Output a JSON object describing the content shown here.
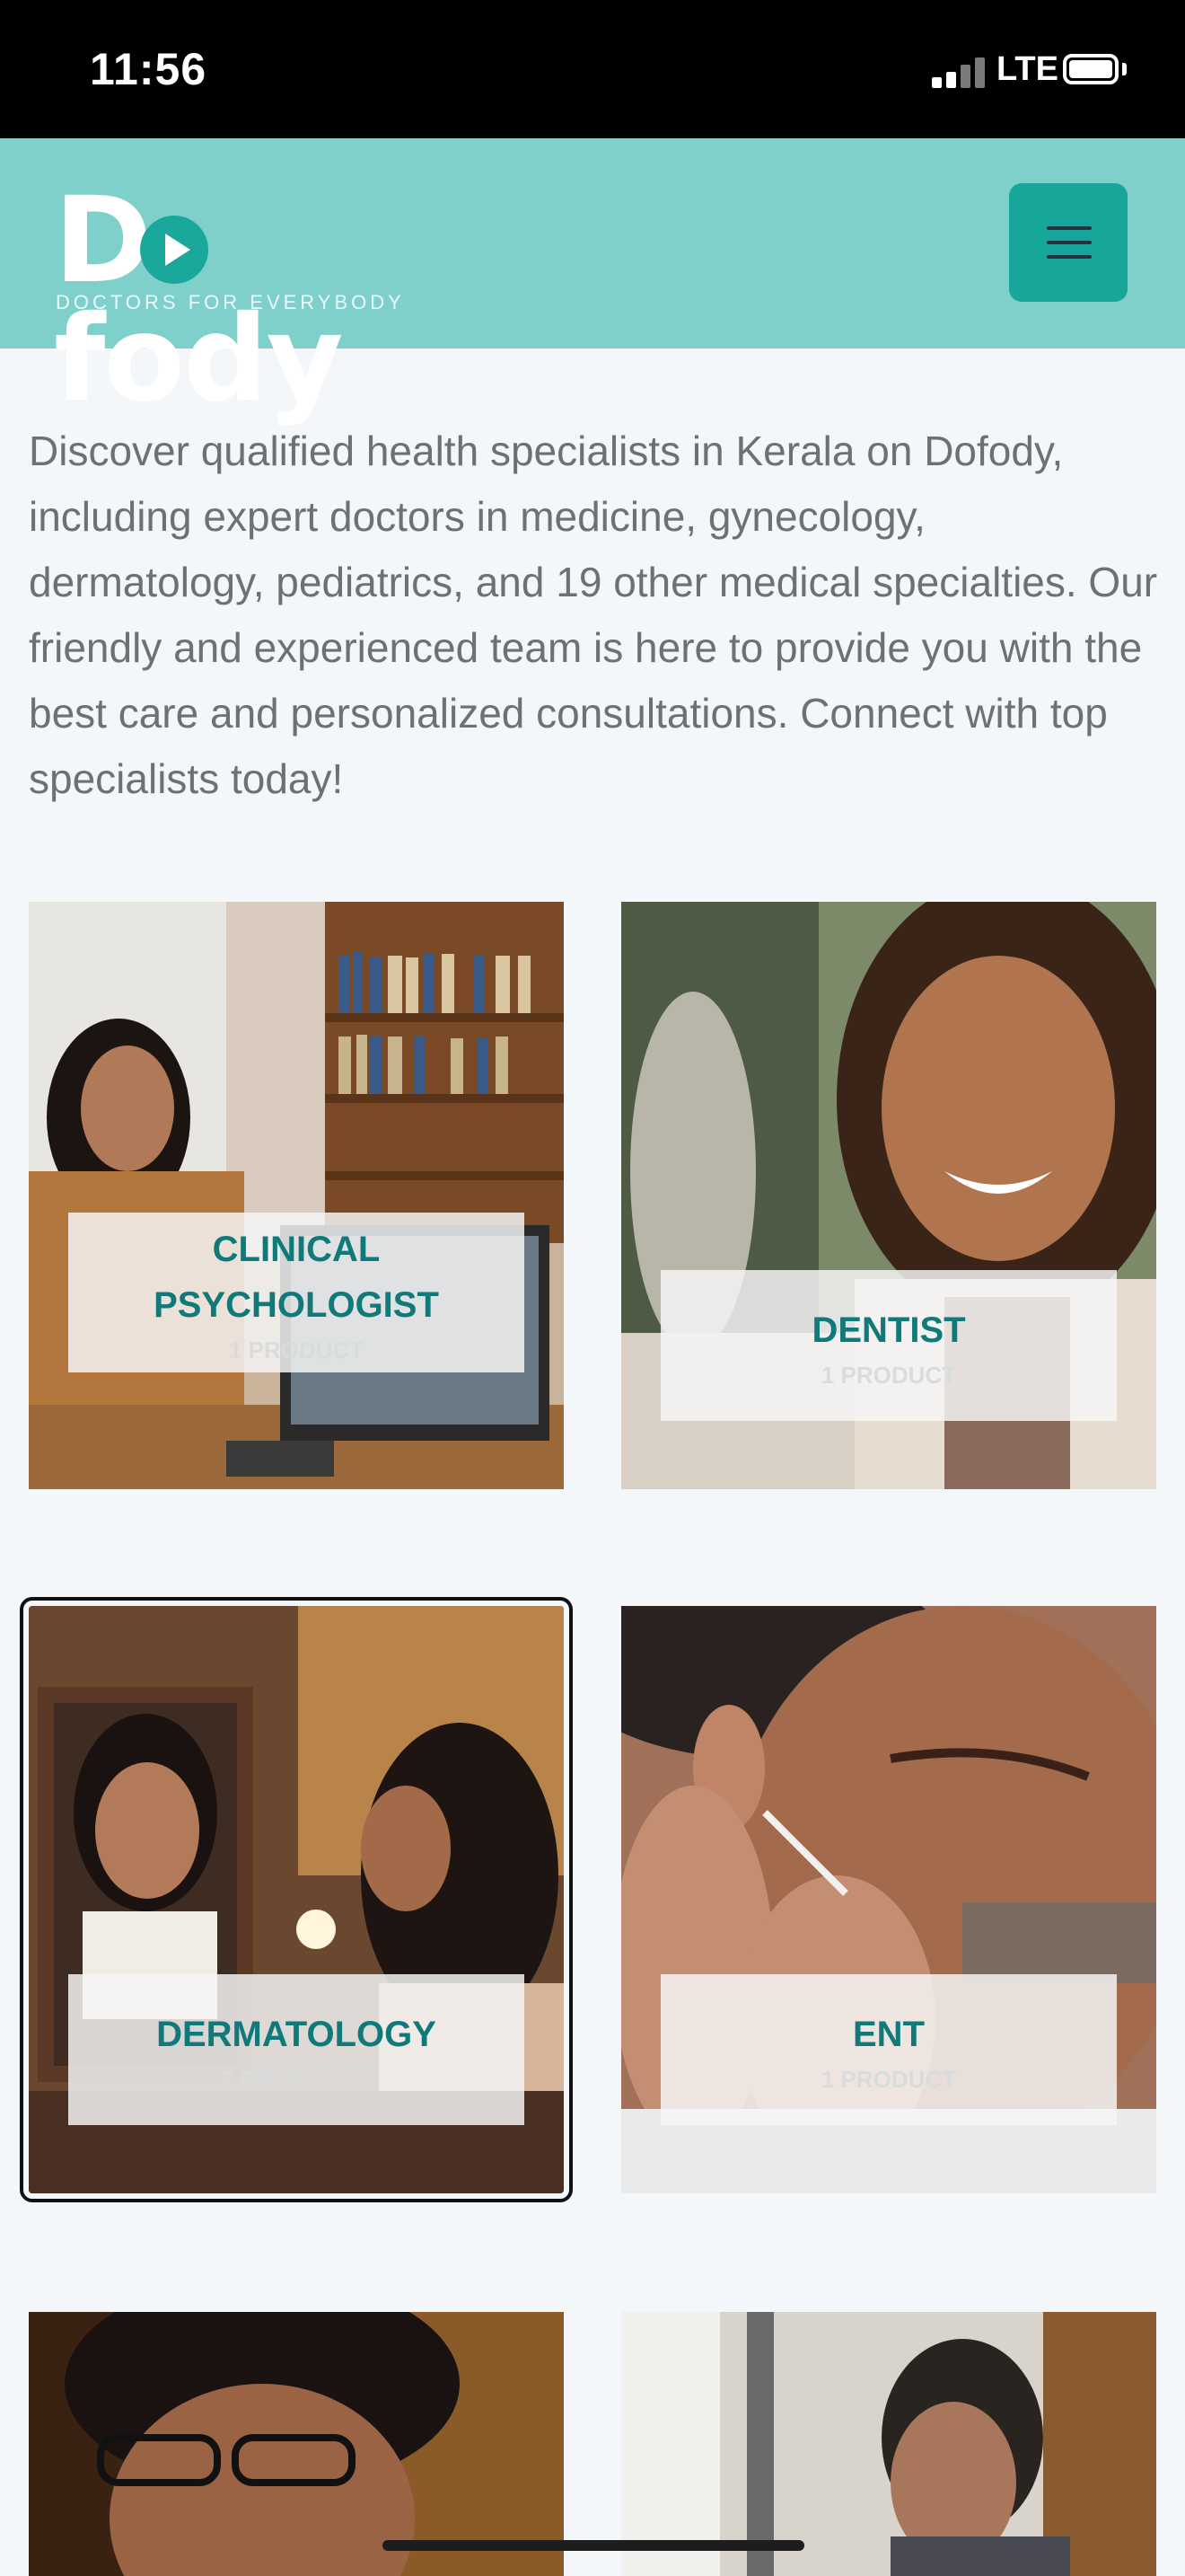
{
  "status_bar": {
    "time": "11:56",
    "carrier": "LTE"
  },
  "header": {
    "logo_text": "Dofody",
    "logo_tagline": "DOCTORS FOR EVERYBODY",
    "menu_icon": "hamburger-menu-icon",
    "brand_color": "#7fd0cb",
    "accent_color": "#16a79a"
  },
  "intro_text": "Discover qualified health specialists in Kerala on Dofody, including expert doctors in medicine, gynecology, dermatology, pediatrics, and 19 other medical specialties. Our friendly and experienced team is here to provide you with the best care and personalized consultations. Connect with top specialists today!",
  "specialties": [
    {
      "title": "CLINICAL PSYCHOLOGIST",
      "subtitle": "1 PRODUCT"
    },
    {
      "title": "DENTIST",
      "subtitle": "1 PRODUCT"
    },
    {
      "title": "DERMATOLOGY",
      "subtitle": "2 PRODUCTS"
    },
    {
      "title": "ENT",
      "subtitle": "1 PRODUCT"
    }
  ]
}
